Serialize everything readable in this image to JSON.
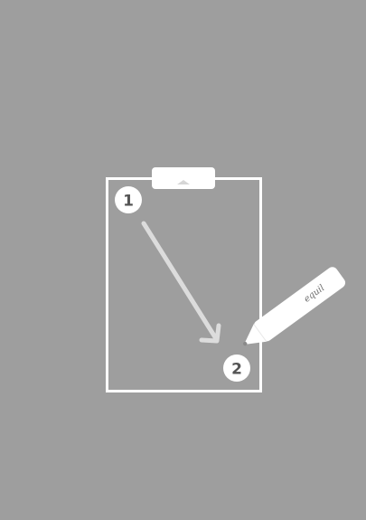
{
  "illustration": {
    "steps": [
      {
        "label": "1"
      },
      {
        "label": "2"
      }
    ],
    "pen": {
      "brand": "equil"
    },
    "colors": {
      "background": "#9e9e9e",
      "outline": "#ffffff",
      "arrow": "#dcdcdc",
      "step_text": "#555555"
    }
  }
}
